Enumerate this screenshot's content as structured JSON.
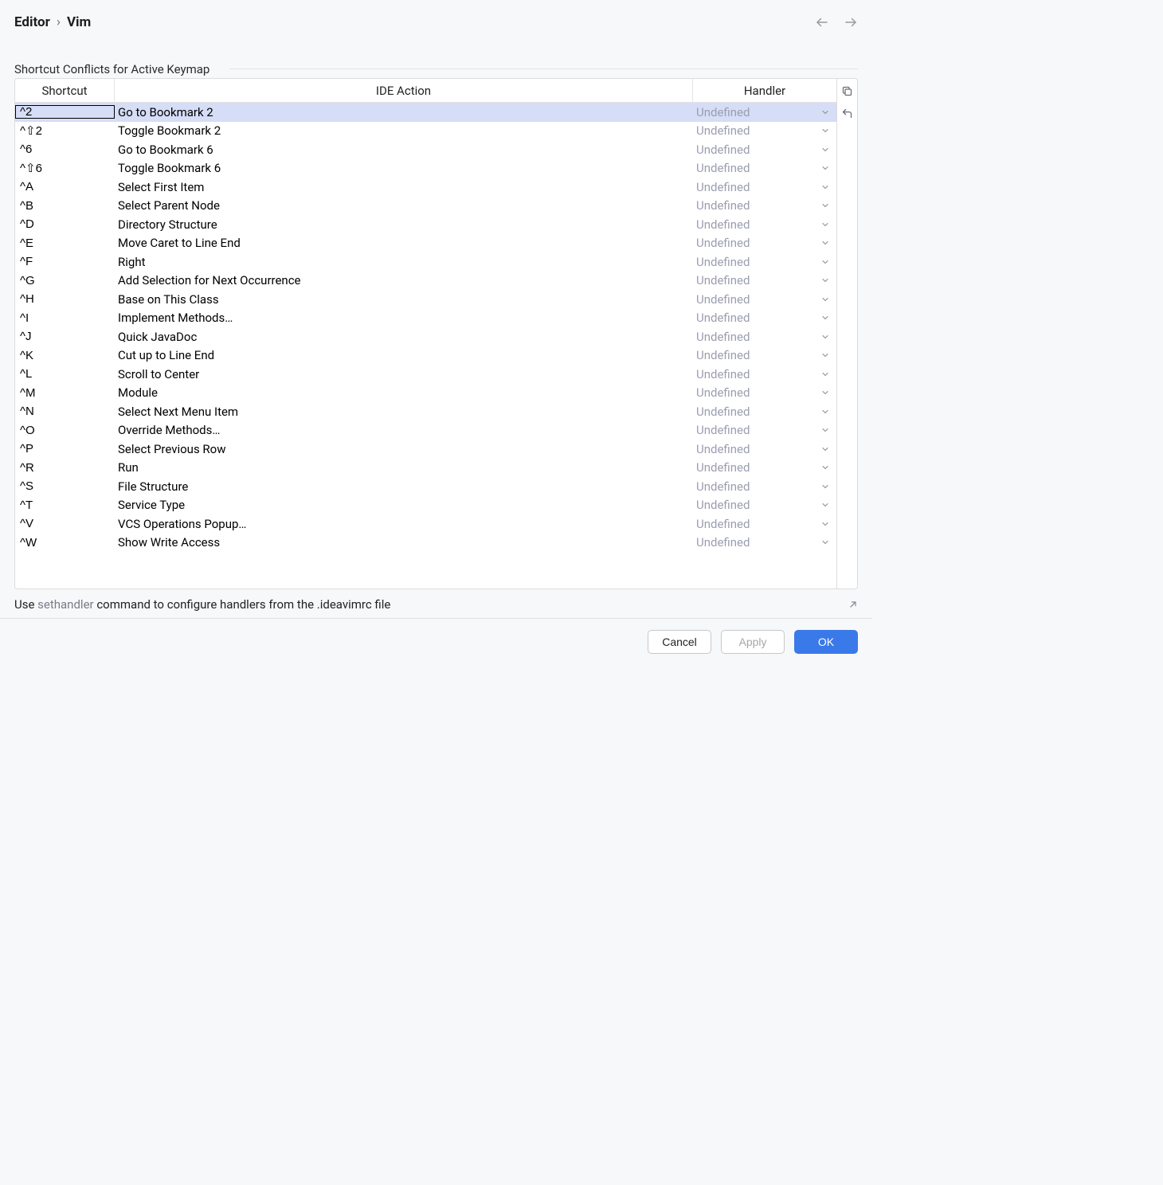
{
  "breadcrumb": {
    "parent": "Editor",
    "separator": "›",
    "current": "Vim"
  },
  "panel": {
    "title": "Shortcut Conflicts for Active Keymap"
  },
  "columns": {
    "shortcut": "Shortcut",
    "ide_action": "IDE Action",
    "handler": "Handler"
  },
  "rows": [
    {
      "shortcut": "^2",
      "action": "Go to Bookmark 2",
      "handler": "Undefined",
      "selected": true
    },
    {
      "shortcut": "^⇧2",
      "action": "Toggle Bookmark 2",
      "handler": "Undefined"
    },
    {
      "shortcut": "^6",
      "action": "Go to Bookmark 6",
      "handler": "Undefined"
    },
    {
      "shortcut": "^⇧6",
      "action": "Toggle Bookmark 6",
      "handler": "Undefined"
    },
    {
      "shortcut": "^A",
      "action": "Select First Item",
      "handler": "Undefined"
    },
    {
      "shortcut": "^B",
      "action": "Select Parent Node",
      "handler": "Undefined"
    },
    {
      "shortcut": "^D",
      "action": "Directory Structure",
      "handler": "Undefined"
    },
    {
      "shortcut": "^E",
      "action": "Move Caret to Line End",
      "handler": "Undefined"
    },
    {
      "shortcut": "^F",
      "action": "Right",
      "handler": "Undefined"
    },
    {
      "shortcut": "^G",
      "action": "Add Selection for Next Occurrence",
      "handler": "Undefined"
    },
    {
      "shortcut": "^H",
      "action": "Base on This Class",
      "handler": "Undefined"
    },
    {
      "shortcut": "^I",
      "action": "Implement Methods…",
      "handler": "Undefined"
    },
    {
      "shortcut": "^J",
      "action": "Quick JavaDoc",
      "handler": "Undefined"
    },
    {
      "shortcut": "^K",
      "action": "Cut up to Line End",
      "handler": "Undefined"
    },
    {
      "shortcut": "^L",
      "action": "Scroll to Center",
      "handler": "Undefined"
    },
    {
      "shortcut": "^M",
      "action": "Module",
      "handler": "Undefined"
    },
    {
      "shortcut": "^N",
      "action": "Select Next Menu Item",
      "handler": "Undefined"
    },
    {
      "shortcut": "^O",
      "action": "Override Methods…",
      "handler": "Undefined"
    },
    {
      "shortcut": "^P",
      "action": "Select Previous Row",
      "handler": "Undefined"
    },
    {
      "shortcut": "^R",
      "action": "Run",
      "handler": "Undefined"
    },
    {
      "shortcut": "^S",
      "action": "File Structure",
      "handler": "Undefined"
    },
    {
      "shortcut": "^T",
      "action": "Service Type",
      "handler": "Undefined"
    },
    {
      "shortcut": "^V",
      "action": "VCS Operations Popup…",
      "handler": "Undefined"
    },
    {
      "shortcut": "^W",
      "action": "Show Write Access",
      "handler": "Undefined"
    }
  ],
  "hint": {
    "prefix": "Use ",
    "command": "sethandler",
    "suffix": " command to configure handlers from the .ideavimrc file"
  },
  "buttons": {
    "cancel": "Cancel",
    "apply": "Apply",
    "ok": "OK"
  }
}
